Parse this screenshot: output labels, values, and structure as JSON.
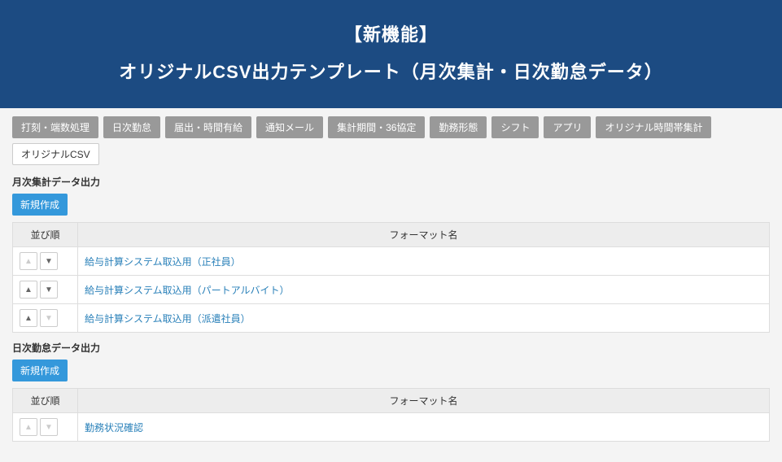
{
  "banner": {
    "line1": "【新機能】",
    "line2": "オリジナルCSV出力テンプレート（月次集計・日次勤怠データ）"
  },
  "tabs": [
    {
      "label": "打刻・端数処理",
      "active": false
    },
    {
      "label": "日次勤怠",
      "active": false
    },
    {
      "label": "届出・時間有給",
      "active": false
    },
    {
      "label": "通知メール",
      "active": false
    },
    {
      "label": "集計期間・36協定",
      "active": false
    },
    {
      "label": "勤務形態",
      "active": false
    },
    {
      "label": "シフト",
      "active": false
    },
    {
      "label": "アプリ",
      "active": false
    },
    {
      "label": "オリジナル時間帯集計",
      "active": false
    },
    {
      "label": "オリジナルCSV",
      "active": true
    }
  ],
  "labels": {
    "create_button": "新規作成",
    "col_order": "並び順",
    "col_format": "フォーマット名",
    "arrow_up": "▲",
    "arrow_down": "▼"
  },
  "monthly": {
    "title": "月次集計データ出力",
    "rows": [
      {
        "name": "給与計算システム取込用（正社員）",
        "up_disabled": true,
        "down_disabled": false
      },
      {
        "name": "給与計算システム取込用（パートアルバイト）",
        "up_disabled": false,
        "down_disabled": false
      },
      {
        "name": "給与計算システム取込用（派遣社員）",
        "up_disabled": false,
        "down_disabled": true
      }
    ]
  },
  "daily": {
    "title": "日次勤怠データ出力",
    "rows": [
      {
        "name": "勤務状況確認",
        "up_disabled": true,
        "down_disabled": true
      }
    ]
  }
}
